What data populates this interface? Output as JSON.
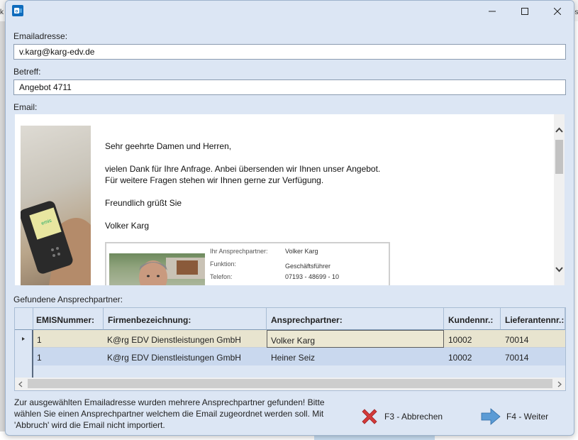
{
  "window": {
    "icon": "outlook-icon",
    "controls": [
      "minimize-icon",
      "maximize-icon",
      "close-icon"
    ]
  },
  "background": {
    "fragment_left": "k",
    "fragment_right": "os"
  },
  "form": {
    "email_label": "Emailadresse:",
    "email_value": "v.karg@karg-edv.de",
    "subject_label": "Betreff:",
    "subject_value": "Angebot 4711",
    "body_label": "Email:"
  },
  "email_body": {
    "greeting": "Sehr geehrte Damen und Herren,",
    "line1": "vielen Dank für Ihre Anfrage. Anbei übersenden wir Ihnen unser Angebot.",
    "line2": "Für weitere Fragen stehen wir Ihnen gerne zur Verfügung.",
    "closing": "Freundlich grüßt Sie",
    "name": "Volker Karg",
    "signature": {
      "contact_label": "Ihr Ansprechpartner:",
      "contact_value": "Volker Karg",
      "function_label": "Funktion:",
      "function_value": "Geschäftsführer",
      "phone_label": "Telefon:",
      "phone_value": "07193 - 48699 - 10"
    }
  },
  "contacts": {
    "section_label": "Gefundene Ansprechpartner:",
    "columns": [
      "EMISNummer:",
      "Firmenbezeichnung:",
      "Ansprechpartner:",
      "Kundennr.:",
      "Lieferantennr.:"
    ],
    "rows": [
      {
        "emis": "1",
        "firma": "K@rg EDV Dienstleistungen GmbH",
        "partner": "Volker Karg",
        "kunde": "10002",
        "lieferant": "70014",
        "selected": true
      },
      {
        "emis": "1",
        "firma": "K@rg EDV Dienstleistungen GmbH",
        "partner": "Heiner Seiz",
        "kunde": "10002",
        "lieferant": "70014",
        "selected": false
      }
    ]
  },
  "footer": {
    "message": "Zur ausgewählten Emailadresse wurden mehrere Ansprechpartner gefunden! Bitte wählen Sie einen Ansprechpartner welchem die Email zugeordnet werden soll. Mit 'Abbruch' wird die Email nicht importiert.",
    "cancel_label": "F3 - Abbrechen",
    "next_label": "F4 - Weiter"
  },
  "colors": {
    "accent": "#0f6cbd",
    "cancel": "#d33a3a",
    "next": "#3d7fc1",
    "selected_row": "#e8e4cf",
    "alt_row": "#c9d8ee"
  }
}
